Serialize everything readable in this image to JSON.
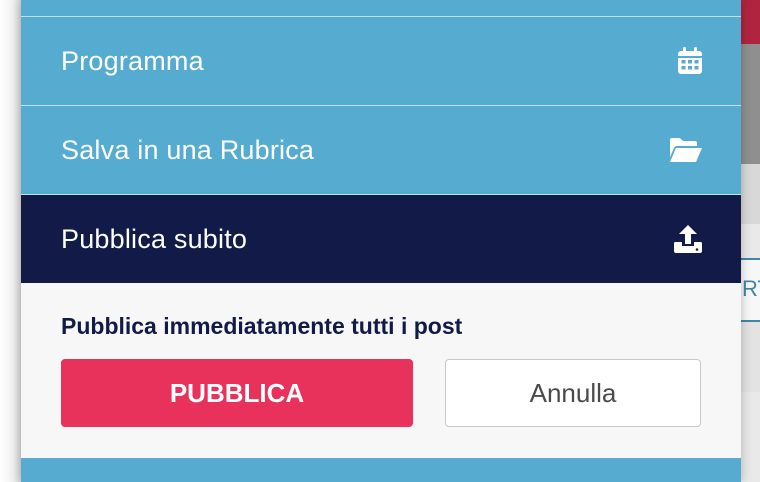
{
  "menu": {
    "items": [
      {
        "label": "Programma",
        "icon": "calendar-icon"
      },
      {
        "label": "Salva in una Rubrica",
        "icon": "folder-open-icon"
      },
      {
        "label": "Pubblica subito",
        "icon": "upload-icon",
        "active": true
      }
    ]
  },
  "confirm": {
    "message": "Pubblica immediatamente tutti i post",
    "publish_label": "PUBBLICA",
    "cancel_label": "Annulla"
  },
  "background": {
    "fragment_text": "RT"
  },
  "colors": {
    "menu_bg": "#55acd0",
    "active_bg": "#121a48",
    "publish_button": "#e8325c",
    "panel_bg": "#f7f7f7"
  }
}
